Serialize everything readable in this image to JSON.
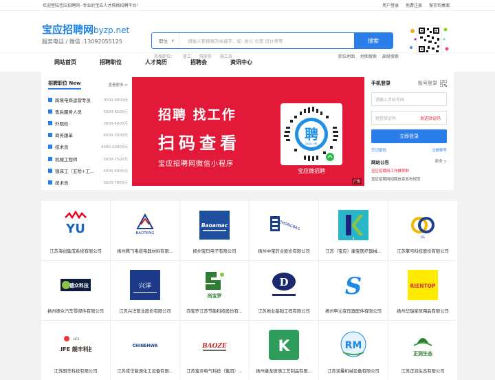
{
  "topbar": {
    "welcome": "欢迎登陆宝应招聘网--专业的宝应人才网络招聘平台！",
    "links": [
      "用户登录",
      "免费注册",
      "保存到桌面"
    ]
  },
  "header": {
    "brand": "宝应招聘网",
    "domain": "byzp.net",
    "tel": "服务电话 / 微信 :13092055125"
  },
  "search": {
    "select": "职位",
    "placeholder": "请输入要搜索的关键字，如: 会计 仓管 设计师等",
    "button": "搜索"
  },
  "hot": {
    "label": "热搜职位：",
    "items": [
      "普工",
      "驾驶员",
      "施工员"
    ]
  },
  "adv_links": [
    "职位地图",
    "地图搜索",
    "高级搜索"
  ],
  "nav": [
    "网站首页",
    "招聘职位",
    "人才简历",
    "招聘会",
    "资讯中心"
  ],
  "jobs": {
    "title": "招聘职位 New",
    "more": "查看更多 >",
    "items": [
      {
        "name": "跨境电商运营专员",
        "salary": "3500-8000元"
      },
      {
        "name": "售后服务人员",
        "salary": "5500-6500元"
      },
      {
        "name": "外观检",
        "salary": "3000-4000元"
      },
      {
        "name": "商务跟单",
        "salary": "4000-5500元"
      },
      {
        "name": "技术员",
        "salary": "4000-10000元"
      },
      {
        "name": "机械工程师",
        "salary": "5000-7500元"
      },
      {
        "name": "镗床工（五险+工...",
        "salary": "4000-6000元"
      },
      {
        "name": "技术员",
        "salary": "5500-7800元"
      }
    ]
  },
  "banner": {
    "line1": "招聘 找工作",
    "line2": "扫码查看",
    "line3": "宝应招聘网微信小程序",
    "code_text": "聘",
    "code_sub": "byzp.net",
    "label": "宝应微招聘",
    "ad": "广告"
  },
  "login": {
    "tab_mobile": "手机登录",
    "tab_account": "账号登录",
    "phone_placeholder": "请输入手机号码",
    "sms_placeholder": "短信验证码",
    "sms_btn": "发送验证码",
    "button": "立即登录",
    "forgot": "忘记密码",
    "register": "注册账号",
    "news_title": "网站公告",
    "news_more": "更多 >",
    "news": [
      "宝应招聘网工作推荐群",
      "宝应招聘网招聘信息发布规范"
    ]
  },
  "companies": [
    {
      "name": "江苏海创集成系统有限公司",
      "logo": "YU"
    },
    {
      "name": "扬州腾飞电缆电器材料有限...",
      "logo": "BAOTENG"
    },
    {
      "name": "扬州宝玛电子有限公司",
      "logo": "Baoamac"
    },
    {
      "name": "扬州中宝药业股份有限公司",
      "logo": "ZHONGBAO"
    },
    {
      "name": "江苏（宝应）康宝医疗器械...",
      "logo": "K"
    },
    {
      "name": "江苏擎弓科技股份有限公司",
      "logo": "QG"
    },
    {
      "name": "扬州德众汽车零部件有限公司",
      "logo": "德众科技"
    },
    {
      "name": "江苏兴洋管业股份有限公司",
      "logo": "兴洋"
    },
    {
      "name": "向宝罗江苏节能科技股份有...",
      "logo": "尚宝罗"
    },
    {
      "name": "江苏地业基础工程有限公司",
      "logo": "D"
    },
    {
      "name": "扬州申沁变压器配件有限公司",
      "logo": "S"
    },
    {
      "name": "扬州华瑞家居用品有限公司",
      "logo": "RIENTOP"
    },
    {
      "name": "江苏朗丰科技有限公司",
      "logo": "LIFE 朗丰科技"
    },
    {
      "name": "江苏成华能源化工设备有限...",
      "logo": "CHINEHWA"
    },
    {
      "name": "江苏宝泽电气科技（集团）...",
      "logo": "BAOZE"
    },
    {
      "name": "扬州康龙玻璃工艺制品有限...",
      "logo": "K"
    },
    {
      "name": "江苏润曼机械设备有限公司",
      "logo": "RM"
    },
    {
      "name": "江苏正润生态有限公司",
      "logo": "正润生态"
    }
  ],
  "colors": {
    "accent": "#2b7de9",
    "banner": "#e3193a",
    "brand": "#1e82e6"
  }
}
